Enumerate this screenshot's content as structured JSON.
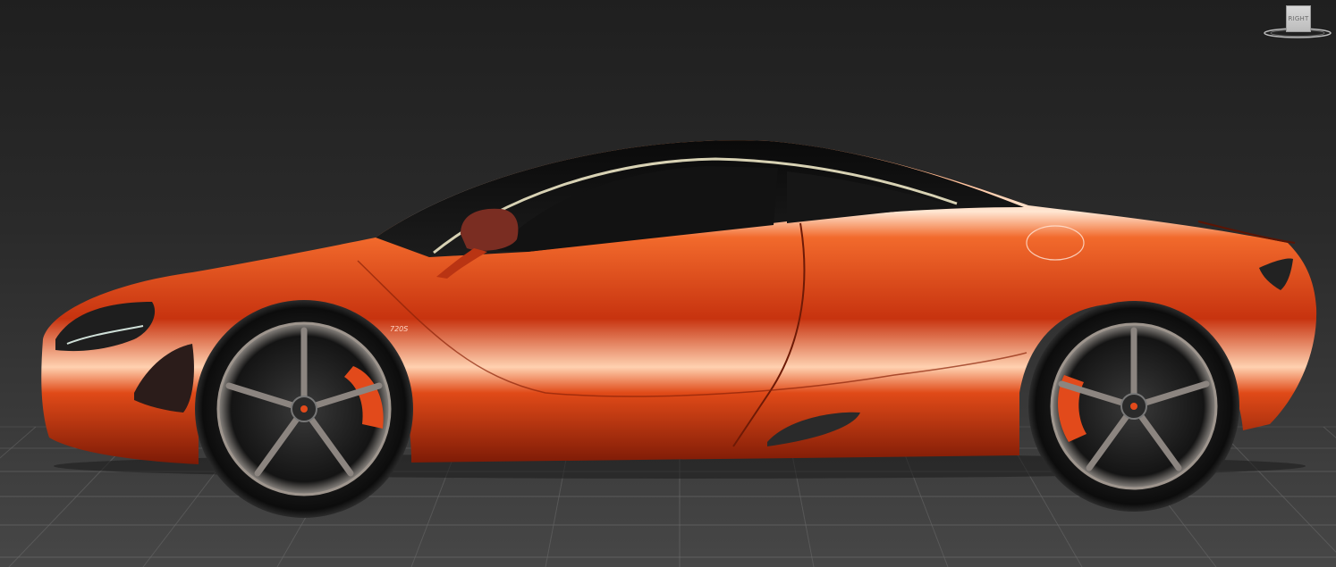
{
  "viewport": {
    "background_color": "#2a2a2a",
    "grid_color": "#6a6a6a"
  },
  "viewcube": {
    "face_label": "RIGHT"
  },
  "model": {
    "body_color": "#e2461a",
    "badge_text": "720S"
  }
}
